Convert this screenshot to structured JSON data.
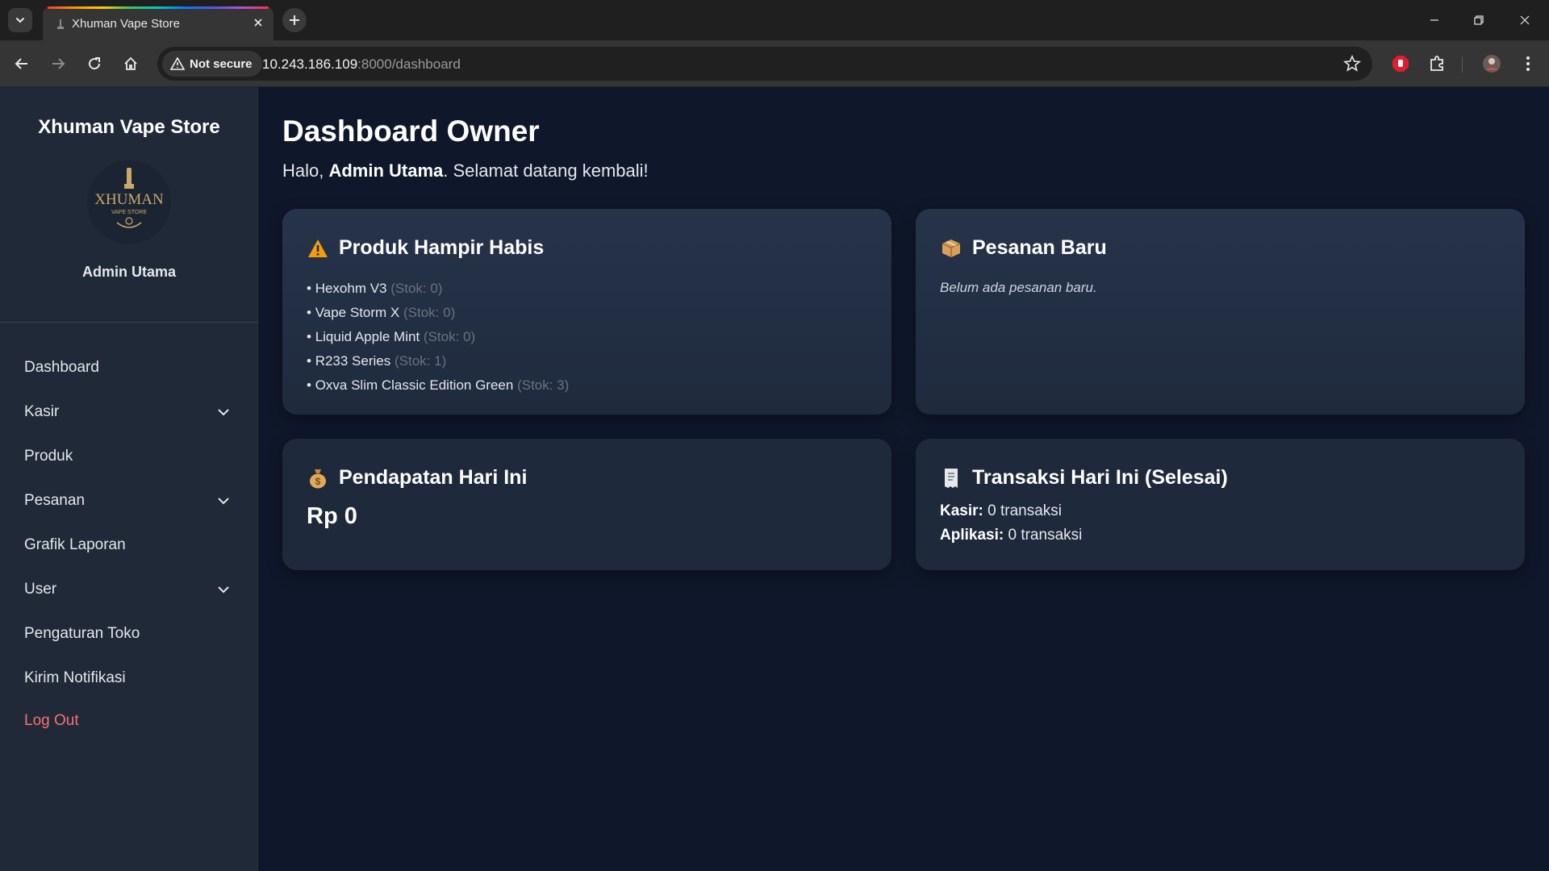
{
  "browser": {
    "tab_title": "Xhuman Vape Store",
    "security_label": "Not secure",
    "url_host": "10.243.186.109",
    "url_rest": ":8000/dashboard"
  },
  "sidebar": {
    "brand": "Xhuman Vape Store",
    "logo_text": "XHUMAN",
    "logo_subtext": "VAPE STORE",
    "admin_name": "Admin Utama",
    "items": [
      {
        "label": "Dashboard",
        "dropdown": false
      },
      {
        "label": "Kasir",
        "dropdown": true
      },
      {
        "label": "Produk",
        "dropdown": false
      },
      {
        "label": "Pesanan",
        "dropdown": true
      },
      {
        "label": "Grafik Laporan",
        "dropdown": false
      },
      {
        "label": "User",
        "dropdown": true
      },
      {
        "label": "Pengaturan Toko",
        "dropdown": false
      },
      {
        "label": "Kirim Notifikasi",
        "dropdown": false
      }
    ],
    "logout": "Log Out"
  },
  "main": {
    "title": "Dashboard Owner",
    "greeting_prefix": "Halo,",
    "greeting_name": "Admin Utama",
    "greeting_suffix": ". Selamat datang kembali!",
    "low_stock": {
      "title": "Produk Hampir Habis",
      "icon": "warning-icon",
      "items": [
        {
          "name": "Hexohm V3",
          "stock": "(Stok: 0)"
        },
        {
          "name": "Vape Storm X",
          "stock": "(Stok: 0)"
        },
        {
          "name": "Liquid Apple Mint",
          "stock": "(Stok: 0)"
        },
        {
          "name": "R233 Series",
          "stock": "(Stok: 1)"
        },
        {
          "name": "Oxva Slim Classic Edition Green",
          "stock": "(Stok: 3)"
        }
      ]
    },
    "new_orders": {
      "title": "Pesanan Baru",
      "icon": "package-icon",
      "empty": "Belum ada pesanan baru."
    },
    "revenue": {
      "title": "Pendapatan Hari Ini",
      "icon": "money-bag-icon",
      "value": "Rp 0"
    },
    "transactions": {
      "title": "Transaksi Hari Ini (Selesai)",
      "icon": "receipt-icon",
      "kasir_label": "Kasir:",
      "kasir_value": "0 transaksi",
      "aplikasi_label": "Aplikasi:",
      "aplikasi_value": "0 transaksi"
    }
  },
  "colors": {
    "sidebar_bg": "#1f2937",
    "main_bg": "#0f172a",
    "card_bg": "#1e293b",
    "logout": "#f87171",
    "warning": "#f59e0b"
  }
}
